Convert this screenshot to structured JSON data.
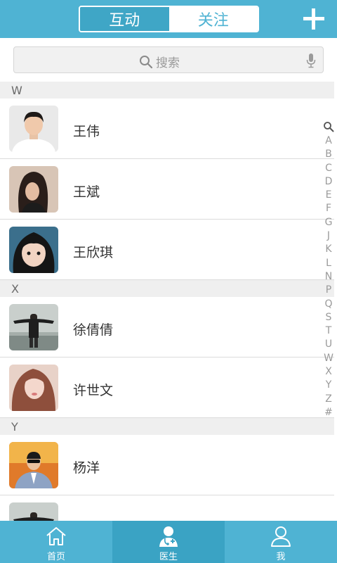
{
  "header": {
    "tabs": [
      {
        "label": "互动",
        "active": true
      },
      {
        "label": "关注",
        "active": false
      }
    ],
    "add_icon": "plus-icon"
  },
  "search": {
    "placeholder": "搜索",
    "icon": "search-icon",
    "voice_icon": "microphone-icon"
  },
  "sections": [
    {
      "letter": "W",
      "contacts": [
        {
          "name": "王伟"
        },
        {
          "name": "王斌"
        },
        {
          "name": "王欣琪"
        }
      ]
    },
    {
      "letter": "X",
      "contacts": [
        {
          "name": "徐倩倩"
        },
        {
          "name": "许世文"
        }
      ]
    },
    {
      "letter": "Y",
      "contacts": [
        {
          "name": "杨洋"
        },
        {
          "name": ""
        }
      ]
    }
  ],
  "index_bar": [
    "A",
    "B",
    "C",
    "D",
    "E",
    "F",
    "G",
    "J",
    "K",
    "L",
    "N",
    "P",
    "Q",
    "S",
    "T",
    "U",
    "W",
    "X",
    "Y",
    "Z",
    "#"
  ],
  "nav": [
    {
      "label": "首页",
      "icon": "home-icon",
      "active": false
    },
    {
      "label": "医生",
      "icon": "doctor-icon",
      "active": true
    },
    {
      "label": "我",
      "icon": "user-icon",
      "active": false
    }
  ],
  "colors": {
    "primary": "#4fb3d3",
    "active_tab": "#3fa6c6",
    "section_bg": "#efefef"
  }
}
